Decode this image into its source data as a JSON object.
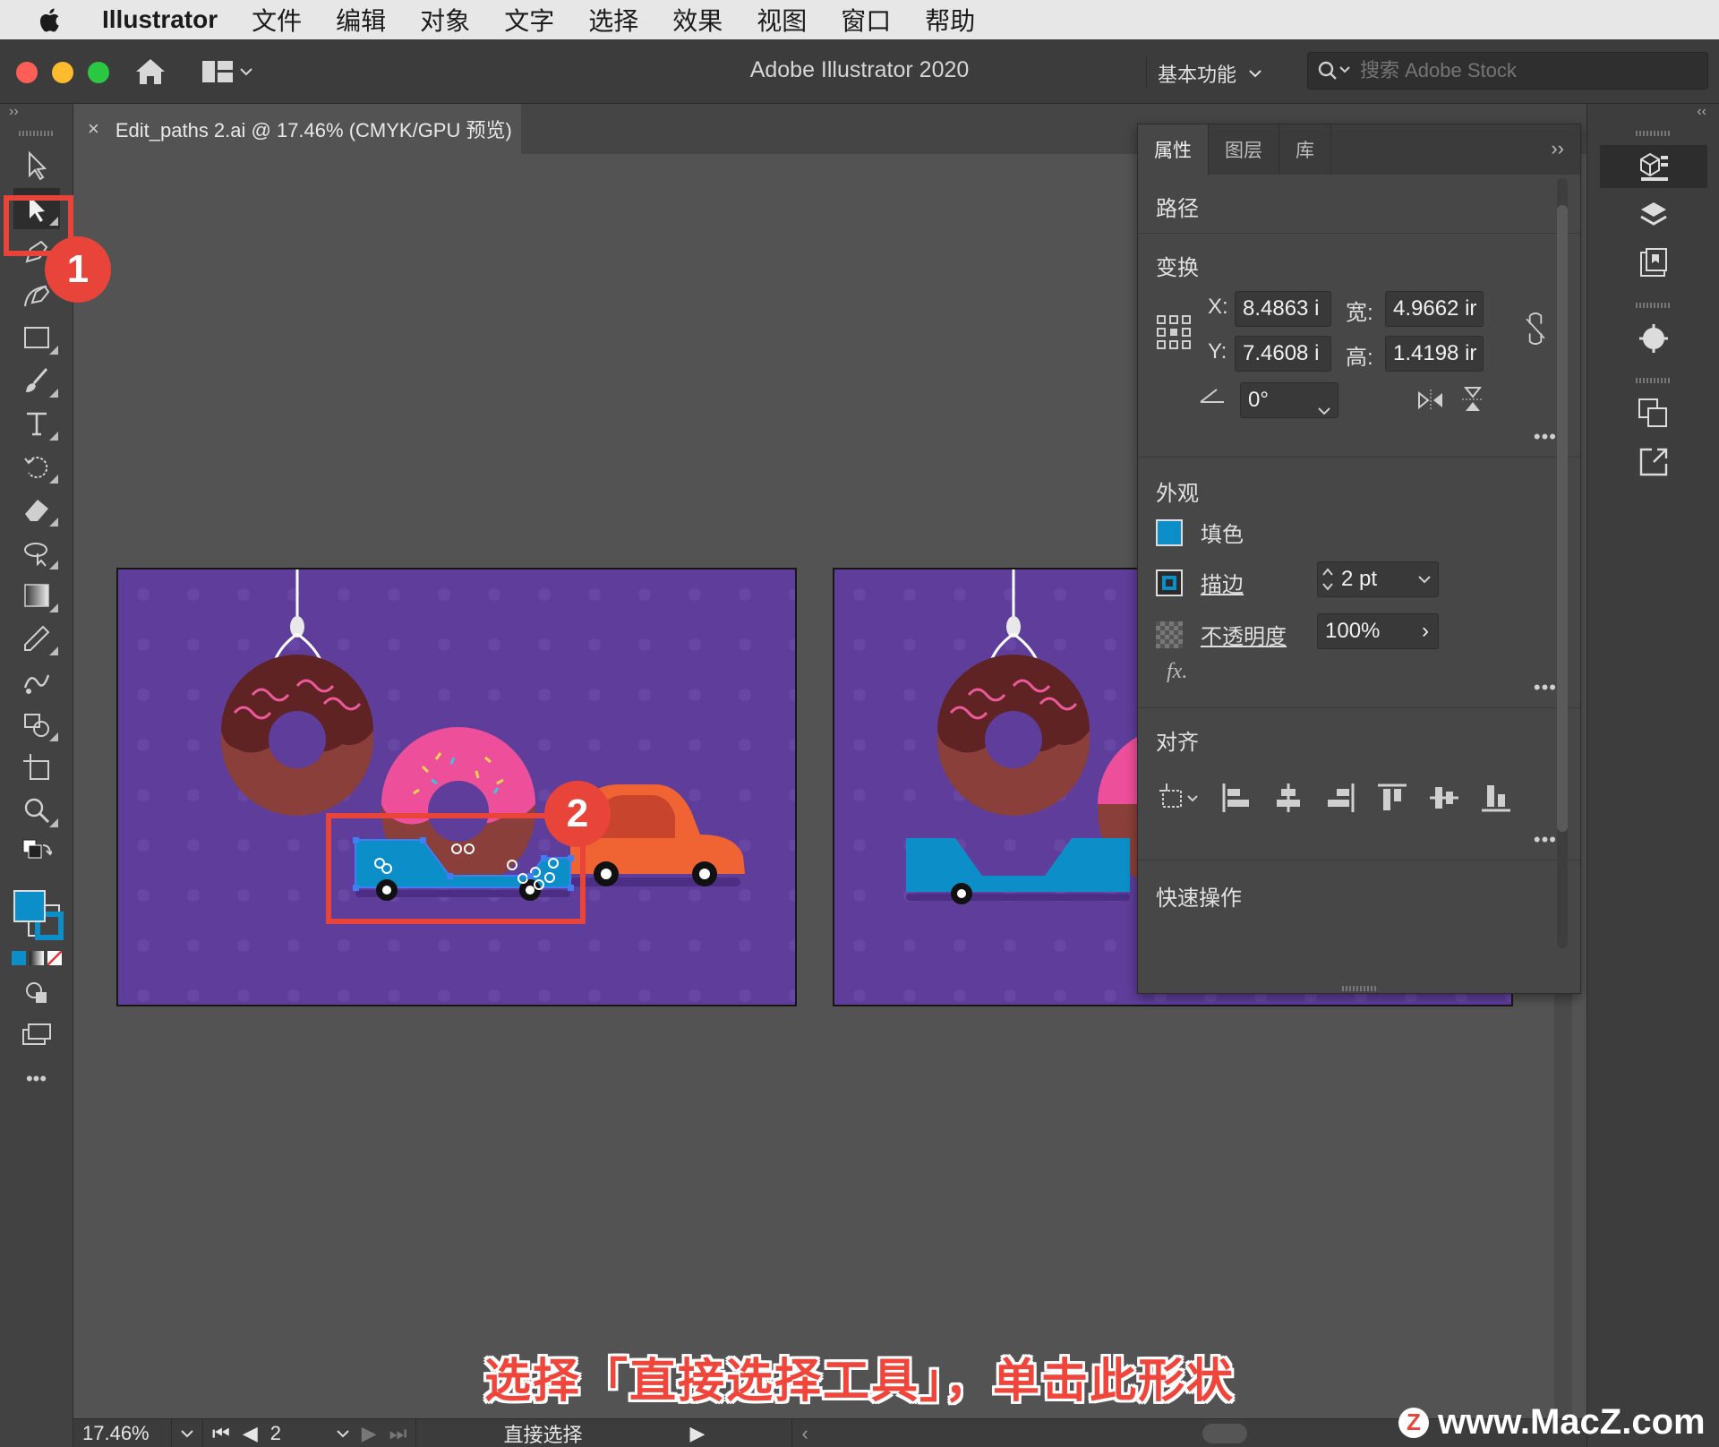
{
  "menubar": {
    "app_name": "Illustrator",
    "items": [
      "文件",
      "编辑",
      "对象",
      "文字",
      "选择",
      "效果",
      "视图",
      "窗口",
      "帮助"
    ]
  },
  "titlebar": {
    "title": "Adobe Illustrator 2020",
    "workspace": "基本功能",
    "search_placeholder": "搜索 Adobe Stock"
  },
  "document_tab": {
    "close": "×",
    "label": "Edit_paths 2.ai @ 17.46% (CMYK/GPU 预览)"
  },
  "left_panel": {
    "collapse": "››",
    "more": "•••"
  },
  "properties": {
    "tabs": [
      "属性",
      "图层",
      "库"
    ],
    "collapse": "››",
    "path_label": "路径",
    "transform": {
      "title": "变换",
      "x_label": "X:",
      "x_value": "8.4863 i",
      "y_label": "Y:",
      "y_value": "7.4608 i",
      "w_label": "宽:",
      "w_value": "4.9662 ir",
      "h_label": "高:",
      "h_value": "1.4198 ir",
      "angle_value": "0°"
    },
    "appearance": {
      "title": "外观",
      "fill_label": "填色",
      "stroke_label": "描边",
      "stroke_value": "2 pt",
      "opacity_label": "不透明度",
      "opacity_value": "100%",
      "fx_label": "fx."
    },
    "align_title": "对齐",
    "quick_actions_title": "快速操作",
    "more": "•••"
  },
  "dock": {
    "collapse": "‹‹"
  },
  "statusbar": {
    "zoom": "17.46%",
    "artboard": "2",
    "tool_name": "直接选择"
  },
  "annotations": {
    "badge1": "1",
    "badge2": "2",
    "caption": "选择「直接选择工具」，单击此形状",
    "watermark_logo": "Z",
    "watermark": "www.MacZ.com"
  },
  "colors": {
    "fill": "#0c8fc8",
    "artboard": "#5e3e9a",
    "accent_red": "#e8443a"
  }
}
